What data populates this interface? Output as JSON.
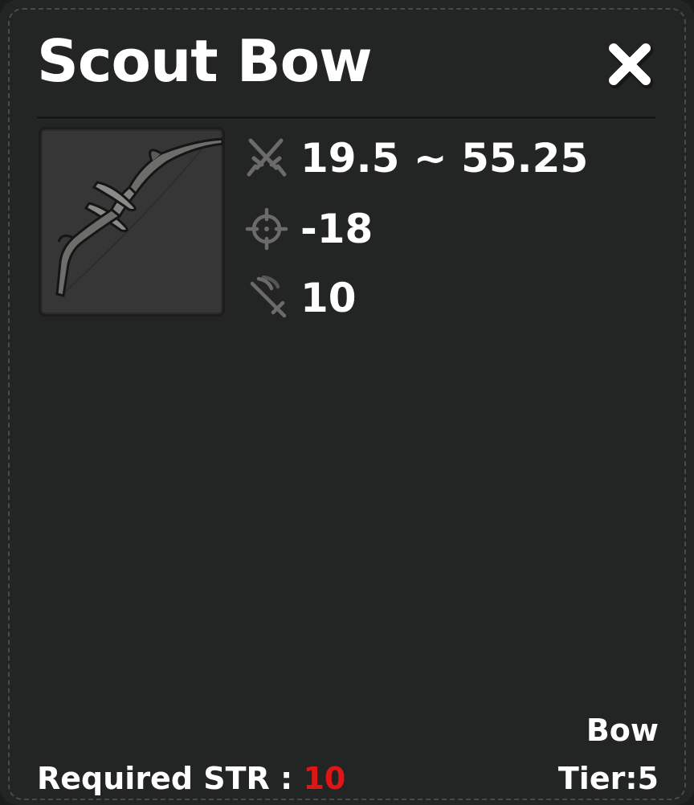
{
  "item": {
    "name": "Scout Bow",
    "icon": "bow-item-icon"
  },
  "close_icon": "close-icon",
  "stats": [
    {
      "icon": "crossed-swords-icon",
      "value": "19.5 ~ 55.25"
    },
    {
      "icon": "crosshair-icon",
      "value": "-18"
    },
    {
      "icon": "sword-speed-icon",
      "value": "10"
    }
  ],
  "requirement": {
    "label": "Required STR : ",
    "value": "10",
    "value_color": "#e01515"
  },
  "weapon_type": "Bow",
  "tier": "Tier:5"
}
